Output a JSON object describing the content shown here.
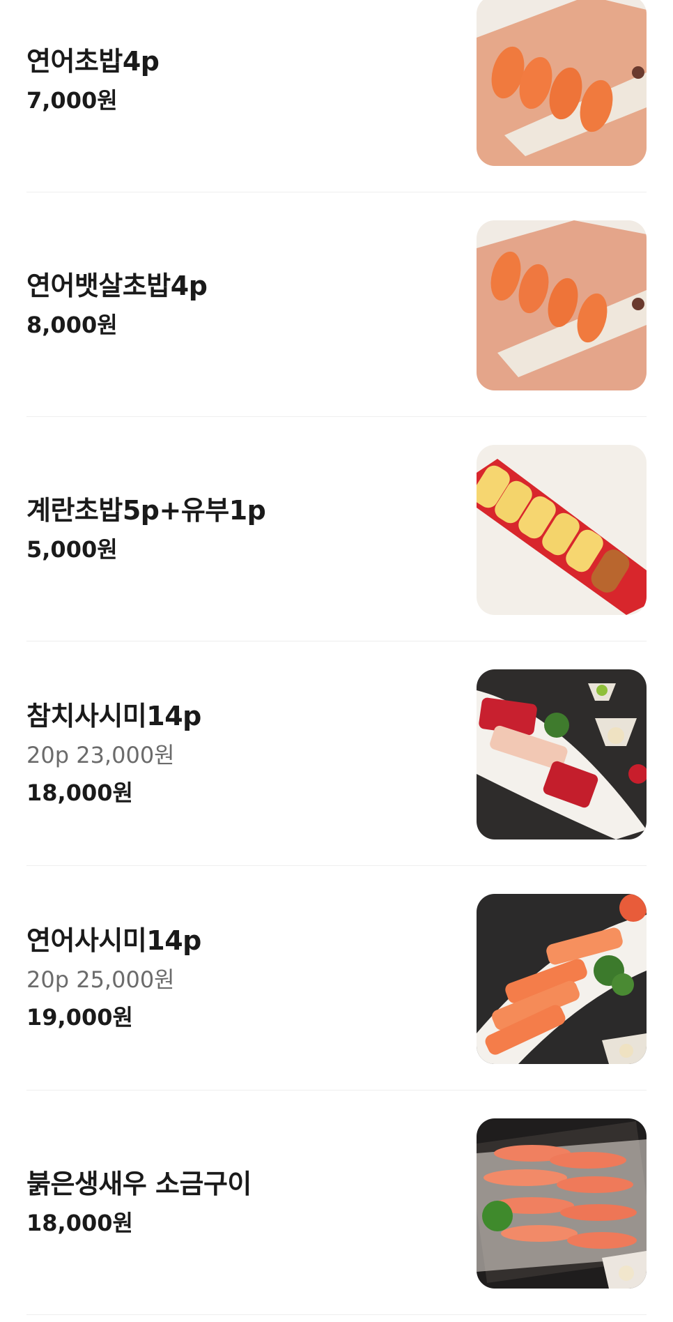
{
  "menu": {
    "items": [
      {
        "name": "연어초밥4p",
        "sub": "",
        "price": "7,000원",
        "image": "salmon-nigiri-photo"
      },
      {
        "name": "연어뱃살초밥4p",
        "sub": "",
        "price": "8,000원",
        "image": "salmon-belly-nigiri-photo"
      },
      {
        "name": "계란초밥5p+유부1p",
        "sub": "",
        "price": "5,000원",
        "image": "egg-sushi-inari-photo"
      },
      {
        "name": "참치사시미14p",
        "sub": "20p 23,000원",
        "price": "18,000원",
        "image": "tuna-sashimi-photo"
      },
      {
        "name": "연어사시미14p",
        "sub": "20p 25,000원",
        "price": "19,000원",
        "image": "salmon-sashimi-photo"
      },
      {
        "name": "붉은생새우 소금구이",
        "sub": "",
        "price": "18,000원",
        "image": "grilled-red-shrimp-photo"
      }
    ]
  },
  "colors": {
    "text": "#1a1a1a",
    "subtext": "#6b6b6b",
    "divider": "#eeeeee"
  }
}
